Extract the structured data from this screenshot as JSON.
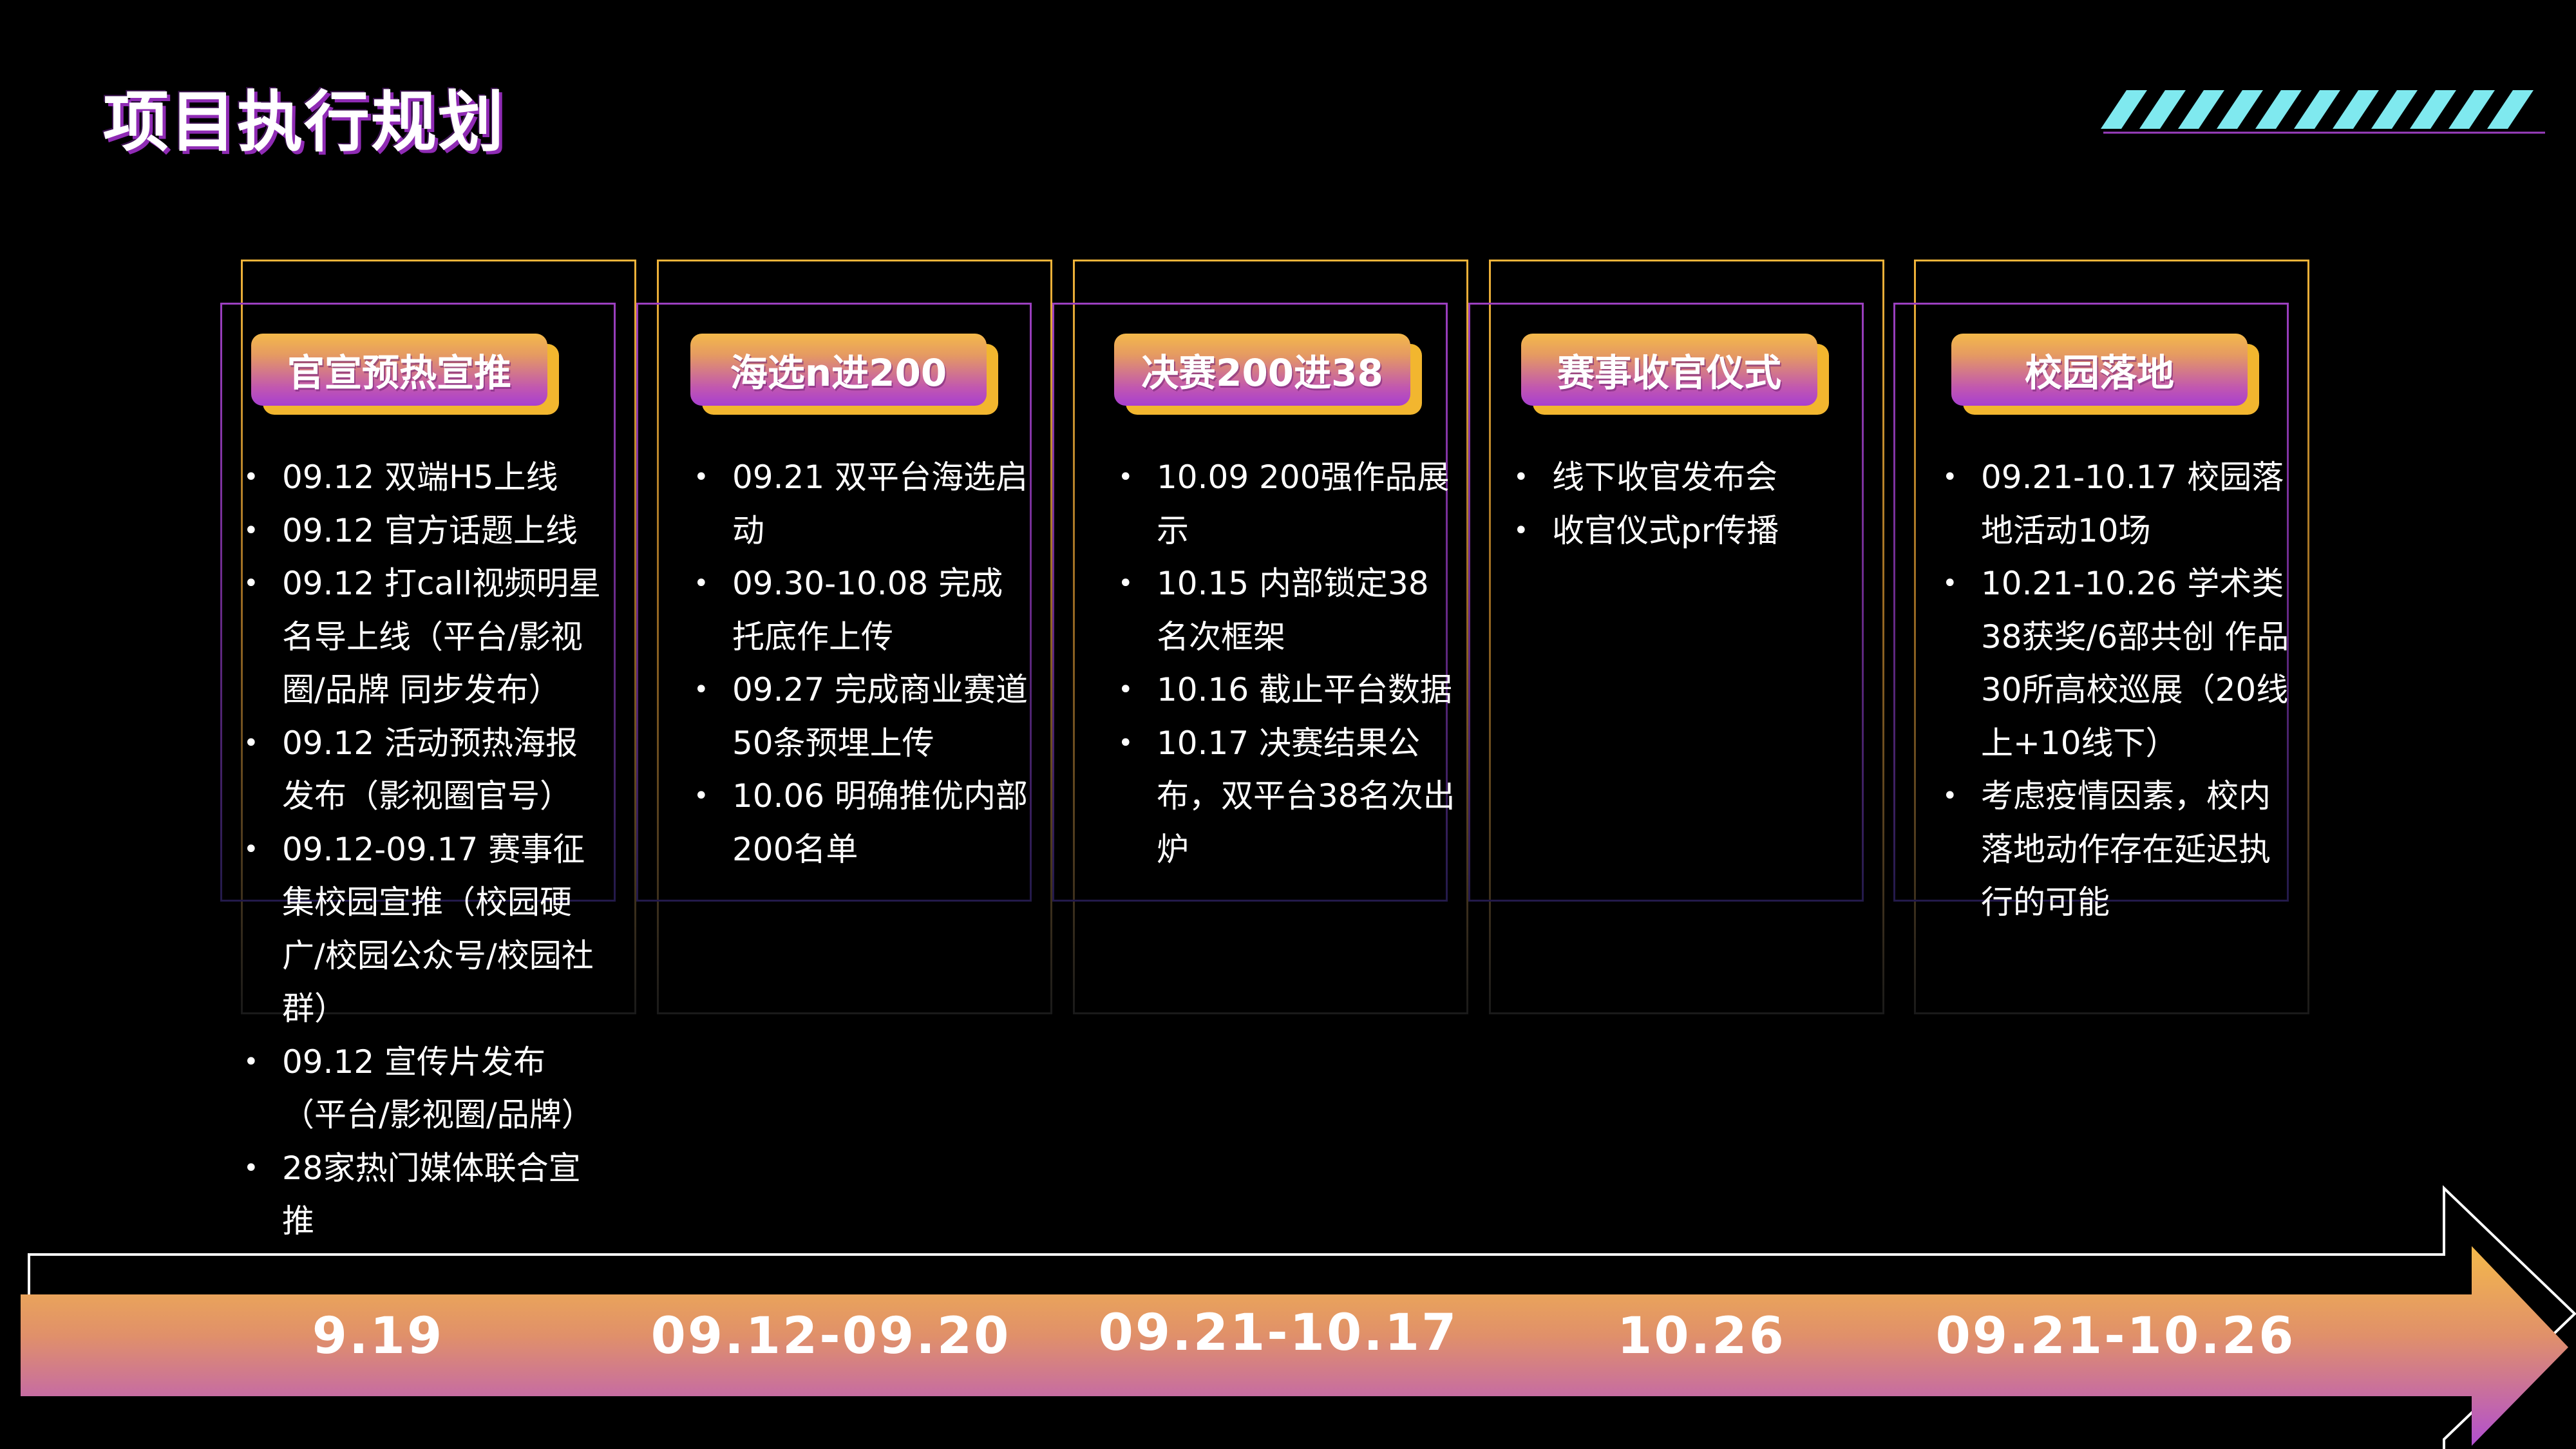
{
  "title": "项目执行规划",
  "colors": {
    "gold": "#f2b62f",
    "purple": "#a83fd0",
    "cyan": "#7fe9ef",
    "background": "#000000"
  },
  "stages": [
    {
      "label": "官宣预热宣推",
      "items": [
        "09.12 双端H5上线",
        "09.12 官方话题上线",
        "09.12 打call视频明星名导上线（平台/影视圈/品牌 同步发布）",
        "09.12 活动预热海报发布（影视圈官号）",
        "09.12-09.17 赛事征集校园宣推（校园硬广/校园公众号/校园社群）",
        "09.12 宣传片发布（平台/影视圈/品牌）",
        "28家热门媒体联合宣推"
      ]
    },
    {
      "label": "海选n进200",
      "items": [
        "09.21 双平台海选启动",
        "09.30-10.08 完成托底作上传",
        "09.27 完成商业赛道50条预埋上传",
        "10.06 明确推优内部200名单"
      ]
    },
    {
      "label": "决赛200进38",
      "items": [
        "10.09 200强作品展示",
        "10.15 内部锁定38名次框架",
        "10.16 截止平台数据",
        "10.17 决赛结果公布，双平台38名次出炉"
      ]
    },
    {
      "label": "赛事收官仪式",
      "items": [
        "线下收官发布会",
        "收官仪式pr传播"
      ]
    },
    {
      "label": "校园落地",
      "items": [
        "09.21-10.17 校园落地活动10场",
        "10.21-10.26 学术类38获奖/6部共创 作品30所高校巡展（20线上+10线下）",
        "考虑疫情因素，校内落地动作存在延迟执行的可能"
      ]
    }
  ],
  "timeline": [
    "9.19",
    "09.12-09.20",
    "09.21-10.17",
    "10.26",
    "09.21-10.26"
  ]
}
